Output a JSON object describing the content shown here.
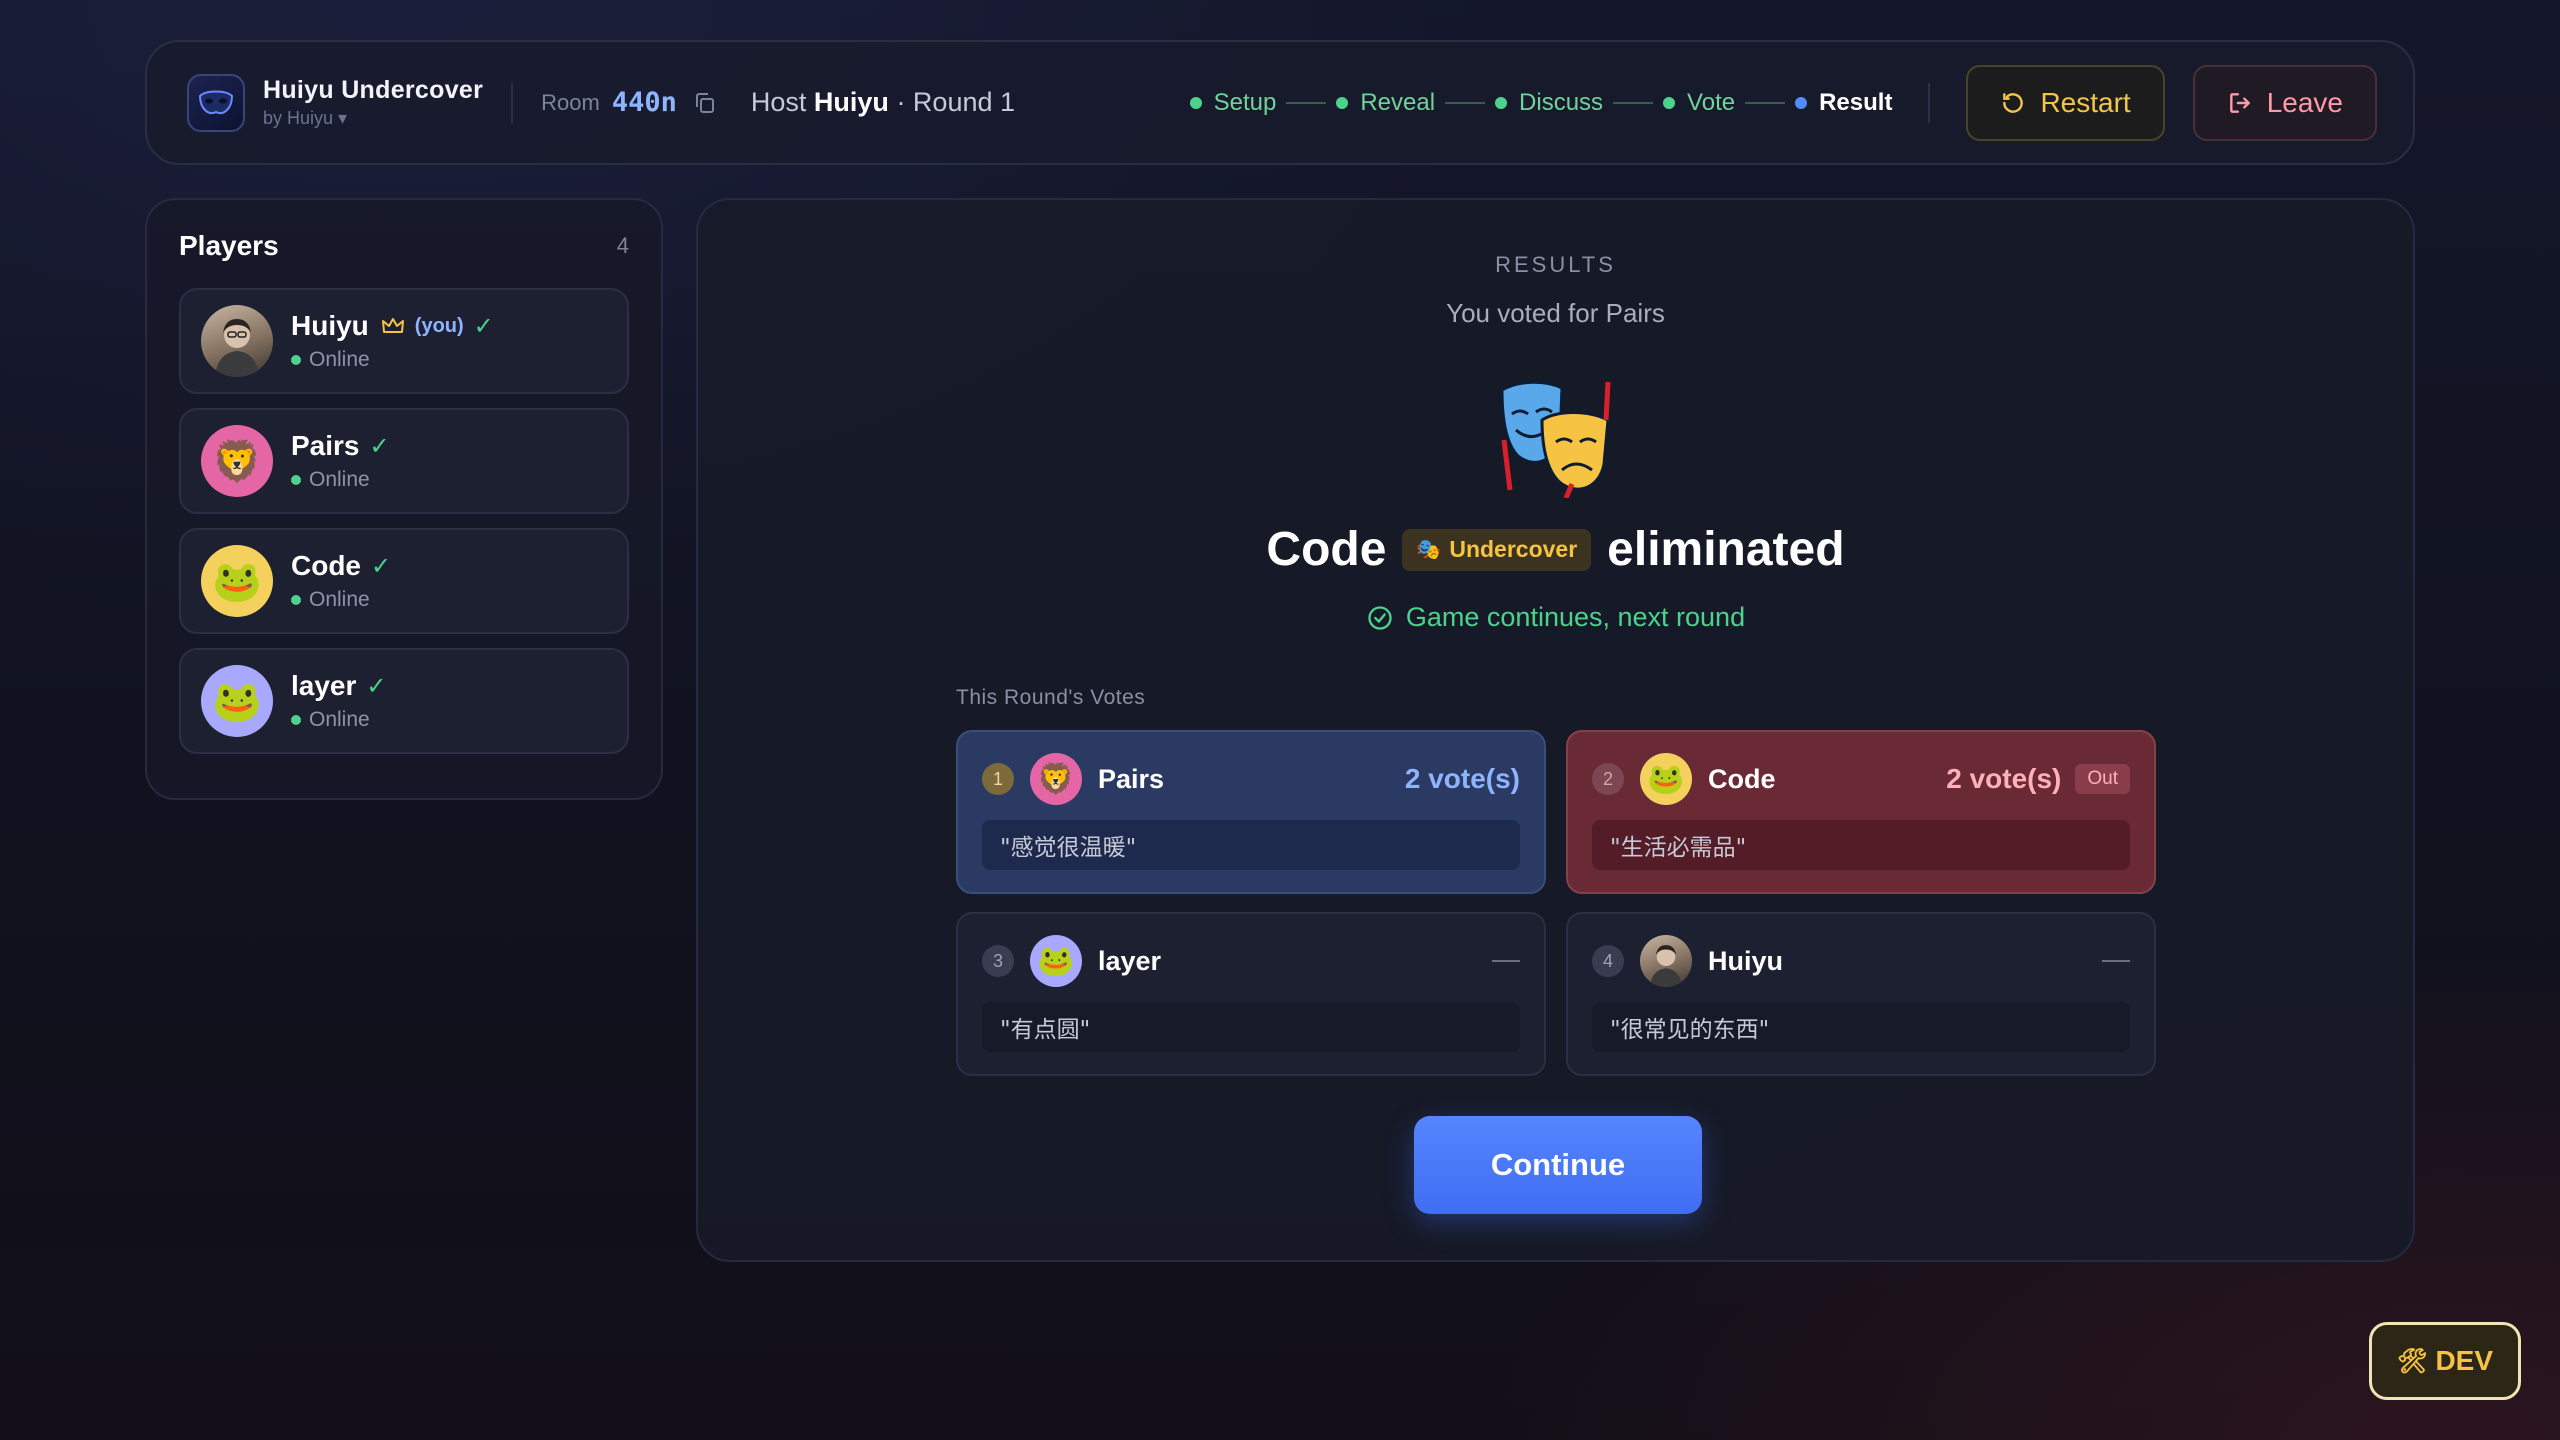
{
  "header": {
    "brand_name": "Huiyu Undercover",
    "brand_sub": "by Huiyu ▾",
    "room_label": "Room",
    "room_code": "440n",
    "host_prefix": "Host",
    "host_name": "Huiyu",
    "round_text": "· Round 1",
    "steps": [
      {
        "label": "Setup",
        "state": "done"
      },
      {
        "label": "Reveal",
        "state": "done"
      },
      {
        "label": "Discuss",
        "state": "done"
      },
      {
        "label": "Vote",
        "state": "done"
      },
      {
        "label": "Result",
        "state": "active"
      }
    ],
    "restart_label": "Restart",
    "leave_label": "Leave"
  },
  "players": {
    "title": "Players",
    "count": "4",
    "list": [
      {
        "name": "Huiyu",
        "you": "(you)",
        "check": "✓",
        "status": "Online",
        "avatar": "photo"
      },
      {
        "name": "Pairs",
        "check": "✓",
        "status": "Online",
        "avatar": "🦁"
      },
      {
        "name": "Code",
        "check": "✓",
        "status": "Online",
        "avatar": "🐸"
      },
      {
        "name": "layer",
        "check": "✓",
        "status": "Online",
        "avatar": "🐸"
      }
    ]
  },
  "result": {
    "label": "RESULTS",
    "voted_for": "You voted for Pairs",
    "eliminated_name": "Code",
    "role_badge": "Undercover",
    "eliminated_word": "eliminated",
    "continues": "Game continues, next round",
    "votes_label": "This Round's Votes",
    "votes": [
      {
        "num": "1",
        "name": "Pairs",
        "avatar": "🦁",
        "count": "2 vote(s)",
        "desc": "\"感觉很温暖\"",
        "style": "top"
      },
      {
        "num": "2",
        "name": "Code",
        "avatar": "🐸",
        "count": "2 vote(s)",
        "out": "Out",
        "desc": "\"生活必需品\"",
        "style": "out"
      },
      {
        "num": "3",
        "name": "layer",
        "avatar": "🐸",
        "desc": "\"有点圆\"",
        "style": "none"
      },
      {
        "num": "4",
        "name": "Huiyu",
        "avatar": "photo",
        "desc": "\"很常见的东西\"",
        "style": "none"
      }
    ],
    "continue_label": "Continue"
  },
  "dev_label": "DEV",
  "colors": {
    "accent": "#4f8dff",
    "success": "#4cd38b",
    "warning": "#f6c343",
    "danger": "#ff9aa6"
  }
}
